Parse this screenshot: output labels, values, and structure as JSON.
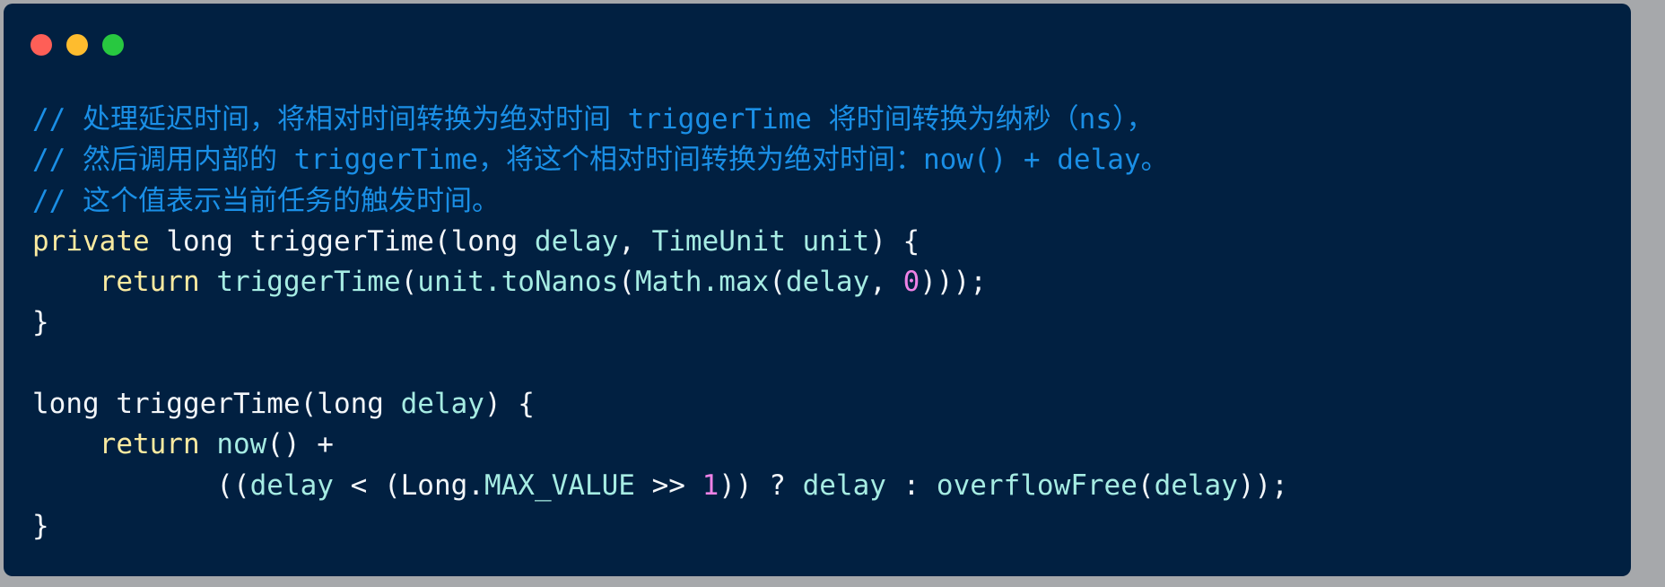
{
  "window": {
    "controls": {
      "close": "close",
      "minimize": "minimize",
      "maximize": "maximize"
    }
  },
  "code": {
    "lines": [
      [
        {
          "t": "// 处理延迟时间，将相对时间转换为绝对时间 triggerTime 将时间转换为纳秒（ns），",
          "c": "c"
        }
      ],
      [
        {
          "t": "// 然后调用内部的 triggerTime，将这个相对时间转换为绝对时间：now() + delay。",
          "c": "c"
        }
      ],
      [
        {
          "t": "// 这个值表示当前任务的触发时间。",
          "c": "c"
        }
      ],
      [
        {
          "t": "private",
          "c": "k"
        },
        {
          "t": " long triggerTime(long ",
          "c": "p"
        },
        {
          "t": "delay",
          "c": "i"
        },
        {
          "t": ", ",
          "c": "p"
        },
        {
          "t": "TimeUnit unit",
          "c": "i"
        },
        {
          "t": ") {",
          "c": "p"
        }
      ],
      [
        {
          "t": "    ",
          "c": "p"
        },
        {
          "t": "return",
          "c": "k"
        },
        {
          "t": " ",
          "c": "p"
        },
        {
          "t": "triggerTime",
          "c": "i"
        },
        {
          "t": "(",
          "c": "p"
        },
        {
          "t": "unit.toNanos",
          "c": "i"
        },
        {
          "t": "(",
          "c": "p"
        },
        {
          "t": "Math.max",
          "c": "i"
        },
        {
          "t": "(",
          "c": "p"
        },
        {
          "t": "delay",
          "c": "i"
        },
        {
          "t": ", ",
          "c": "p"
        },
        {
          "t": "0",
          "c": "n"
        },
        {
          "t": ")));",
          "c": "p"
        }
      ],
      [
        {
          "t": "}",
          "c": "p"
        }
      ],
      [
        {
          "t": "",
          "c": "p"
        }
      ],
      [
        {
          "t": "long triggerTime(long ",
          "c": "p"
        },
        {
          "t": "delay",
          "c": "i"
        },
        {
          "t": ") {",
          "c": "p"
        }
      ],
      [
        {
          "t": "    ",
          "c": "p"
        },
        {
          "t": "return",
          "c": "k"
        },
        {
          "t": " ",
          "c": "p"
        },
        {
          "t": "now",
          "c": "i"
        },
        {
          "t": "() +",
          "c": "p"
        }
      ],
      [
        {
          "t": "           ((",
          "c": "p"
        },
        {
          "t": "delay",
          "c": "i"
        },
        {
          "t": " < (Long.",
          "c": "p"
        },
        {
          "t": "MAX_VALUE",
          "c": "i"
        },
        {
          "t": " >> ",
          "c": "p"
        },
        {
          "t": "1",
          "c": "n"
        },
        {
          "t": ")) ? ",
          "c": "p"
        },
        {
          "t": "delay",
          "c": "i"
        },
        {
          "t": " : ",
          "c": "p"
        },
        {
          "t": "overflowFree",
          "c": "i"
        },
        {
          "t": "(",
          "c": "p"
        },
        {
          "t": "delay",
          "c": "i"
        },
        {
          "t": "));",
          "c": "p"
        }
      ],
      [
        {
          "t": "}",
          "c": "p"
        }
      ]
    ]
  },
  "colors": {
    "background": "#012041",
    "comment": "#1a8fe6",
    "keyword": "#f9eaa0",
    "plain": "#f3f6f9",
    "identifier": "#a6ece3",
    "number": "#ee82e6"
  }
}
